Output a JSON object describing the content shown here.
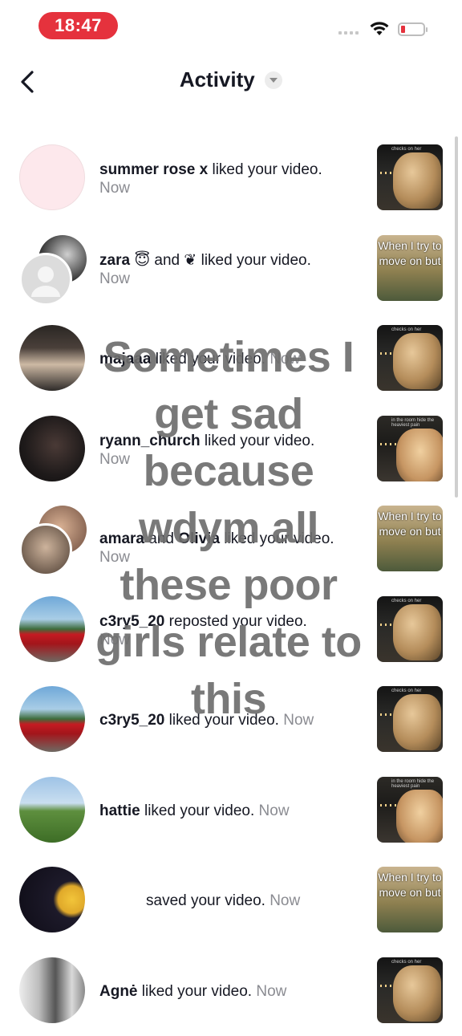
{
  "status_bar": {
    "time": "18:47",
    "accent_color": "#e5323d",
    "icons": [
      "signal-icon",
      "wifi-icon",
      "battery-icon"
    ]
  },
  "header": {
    "title": "Activity",
    "back_icon": "chevron-left-icon",
    "dropdown_icon": "caret-down-icon"
  },
  "notifications": [
    {
      "username": "summer rose x",
      "action": " liked your video.",
      "time": "Now",
      "thumb": "night"
    },
    {
      "username": "zara",
      "emoji": "😇",
      "mid": " and ",
      "second": "❦",
      "action": " liked your video.",
      "time": "Now",
      "thumb": "move"
    },
    {
      "username": "majaaa",
      "action": " liked your video.",
      "time": "Now",
      "thumb": "night"
    },
    {
      "username": "ryann_church",
      "action": " liked your video.",
      "time": "Now",
      "thumb": "pink"
    },
    {
      "username": "amara",
      "mid": " and ",
      "second": "Olivia",
      "action": " liked your video.",
      "time": "Now",
      "thumb": "move"
    },
    {
      "username": "c3ry5_20",
      "action": " reposted your video.",
      "time": "Now",
      "thumb": "night"
    },
    {
      "username": "c3ry5_20",
      "action": " liked your video.",
      "time": "Now",
      "thumb": "night"
    },
    {
      "username": "hattie",
      "action": " liked your video.",
      "time": "Now",
      "thumb": "pink"
    },
    {
      "username": "",
      "action": "saved your video.",
      "time": "Now",
      "thumb": "move"
    },
    {
      "username": "Agnė",
      "action": " liked your video.",
      "time": "Now",
      "thumb": "night"
    }
  ],
  "thumb_texts": {
    "night_caption": "checks on her",
    "pink_caption": "in the room hide the heaviest pain",
    "move_caption": "When I try to move on but"
  },
  "overlay_caption": "Sometimes I get sad because wdym all these poor girls relate to this"
}
